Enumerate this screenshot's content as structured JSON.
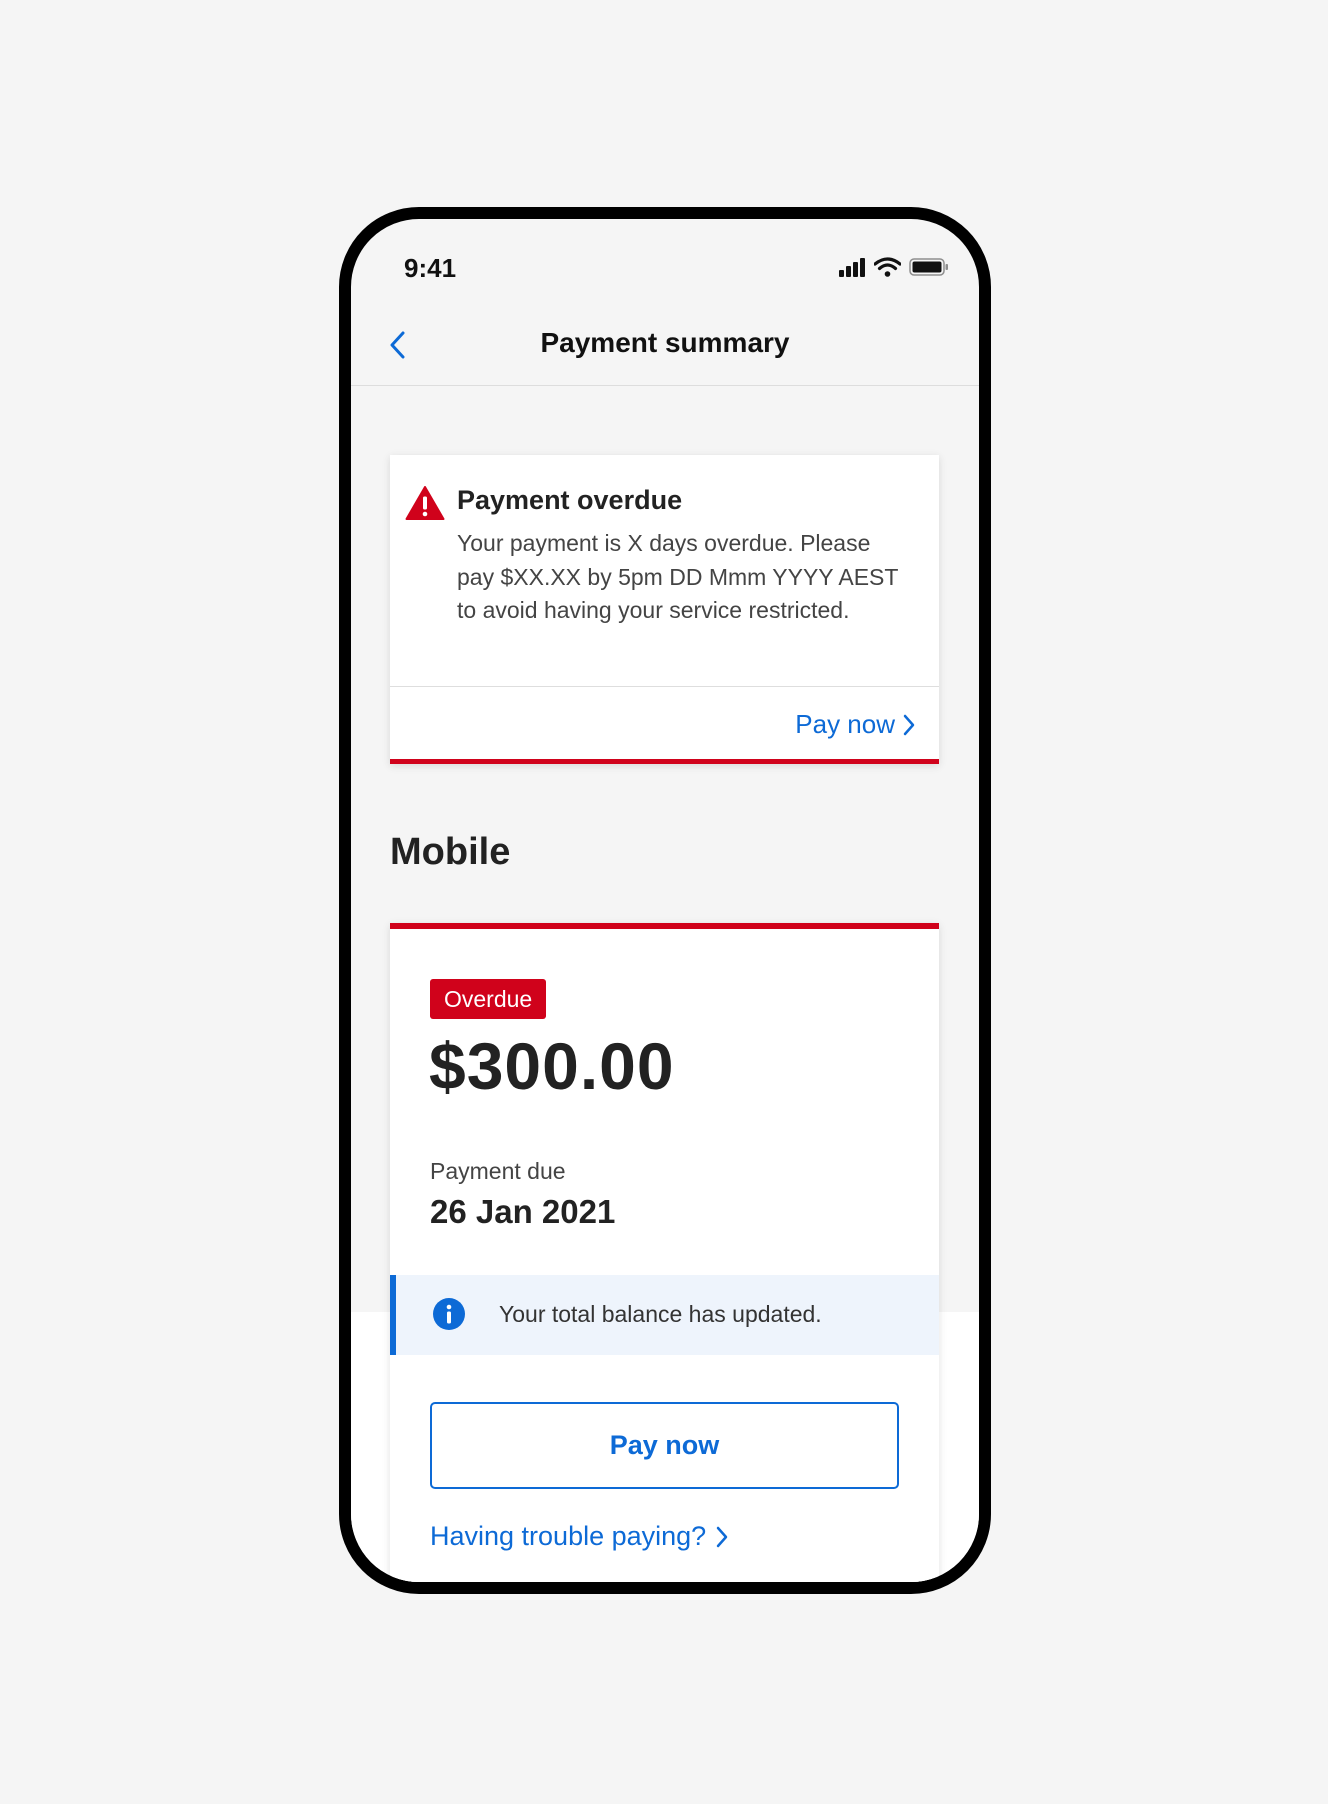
{
  "status_bar": {
    "time": "9:41"
  },
  "nav": {
    "title": "Payment summary"
  },
  "alert": {
    "title": "Payment overdue",
    "body": "Your payment is X days overdue. Please pay $XX.XX by 5pm DD Mmm YYYY AEST to avoid having your service restricted.",
    "link_label": "Pay now"
  },
  "section": {
    "title": "Mobile"
  },
  "bill": {
    "status": "Overdue",
    "amount": "$300.00",
    "due_label": "Payment due",
    "due_date": "26 Jan 2021",
    "info_message": "Your total balance has updated.",
    "pay_button_label": "Pay now",
    "help_link_label": "Having trouble paying?"
  },
  "colors": {
    "accent_blue": "#0d6ad6",
    "alert_red": "#d0021b",
    "background": "#f5f5f5"
  },
  "icons": [
    "back-chevron",
    "signal",
    "wifi",
    "battery",
    "warning-triangle",
    "info-circle",
    "chevron-right"
  ]
}
